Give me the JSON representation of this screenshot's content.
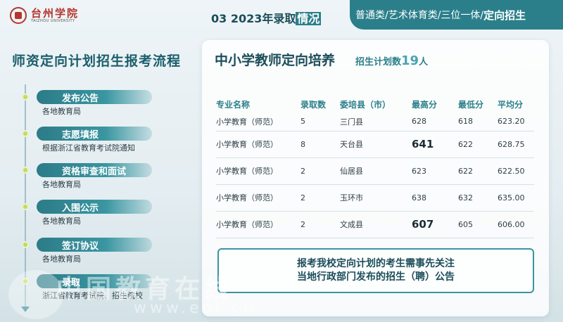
{
  "header": {
    "logo_cn": "台州学院",
    "logo_en": "TAIZHOU UNIVERSITY",
    "section_title_prefix": "03  2023年录取",
    "section_title_accent": "情况",
    "categories_text": "普通类/艺术体育类/三位一体/",
    "categories_active": "定向招生"
  },
  "left_panel": {
    "title": "师资定向计划招生报考流程",
    "steps": [
      {
        "label": "发布公告",
        "sub": "各地教育局"
      },
      {
        "label": "志愿填报",
        "sub": "根据浙江省教育考试院通知"
      },
      {
        "label": "资格审查和面试",
        "sub": "各地教育局"
      },
      {
        "label": "入围公示",
        "sub": "各地教育局"
      },
      {
        "label": "签订协议",
        "sub": "各地教育局"
      },
      {
        "label": "录取",
        "sub": "浙江省教育考试院、招生院校"
      }
    ]
  },
  "card": {
    "title": "中小学教师定向培养",
    "plan_label": "招生计划数",
    "plan_count": "19",
    "plan_unit": "人",
    "columns": [
      "专业名称",
      "录取数",
      "委培县（市）",
      "最高分",
      "最低分",
      "平均分"
    ],
    "rows": [
      [
        "小学教育（师范）",
        "5",
        "三门县",
        "628",
        "618",
        "623.20"
      ],
      [
        "小学教育（师范）",
        "8",
        "天台县",
        "641",
        "622",
        "628.75"
      ],
      [
        "小学教育（师范）",
        "2",
        "仙居县",
        "623",
        "622",
        "622.50"
      ],
      [
        "小学教育（师范）",
        "2",
        "玉环市",
        "638",
        "632",
        "635.00"
      ],
      [
        "小学教育（师范）",
        "2",
        "文成县",
        "607",
        "605",
        "606.00"
      ]
    ],
    "notice_line1": "报考我校定向计划的考生需事先关注",
    "notice_line2": "当地行政部门发布的招生（聘）公告"
  },
  "watermark": {
    "cn": "中国教育在线",
    "en": "www.eol.cn"
  },
  "colors": {
    "primary": "#2b7f8a",
    "accent": "#4aa4b3",
    "dot": "#c6da5a",
    "logo": "#b5342d"
  }
}
